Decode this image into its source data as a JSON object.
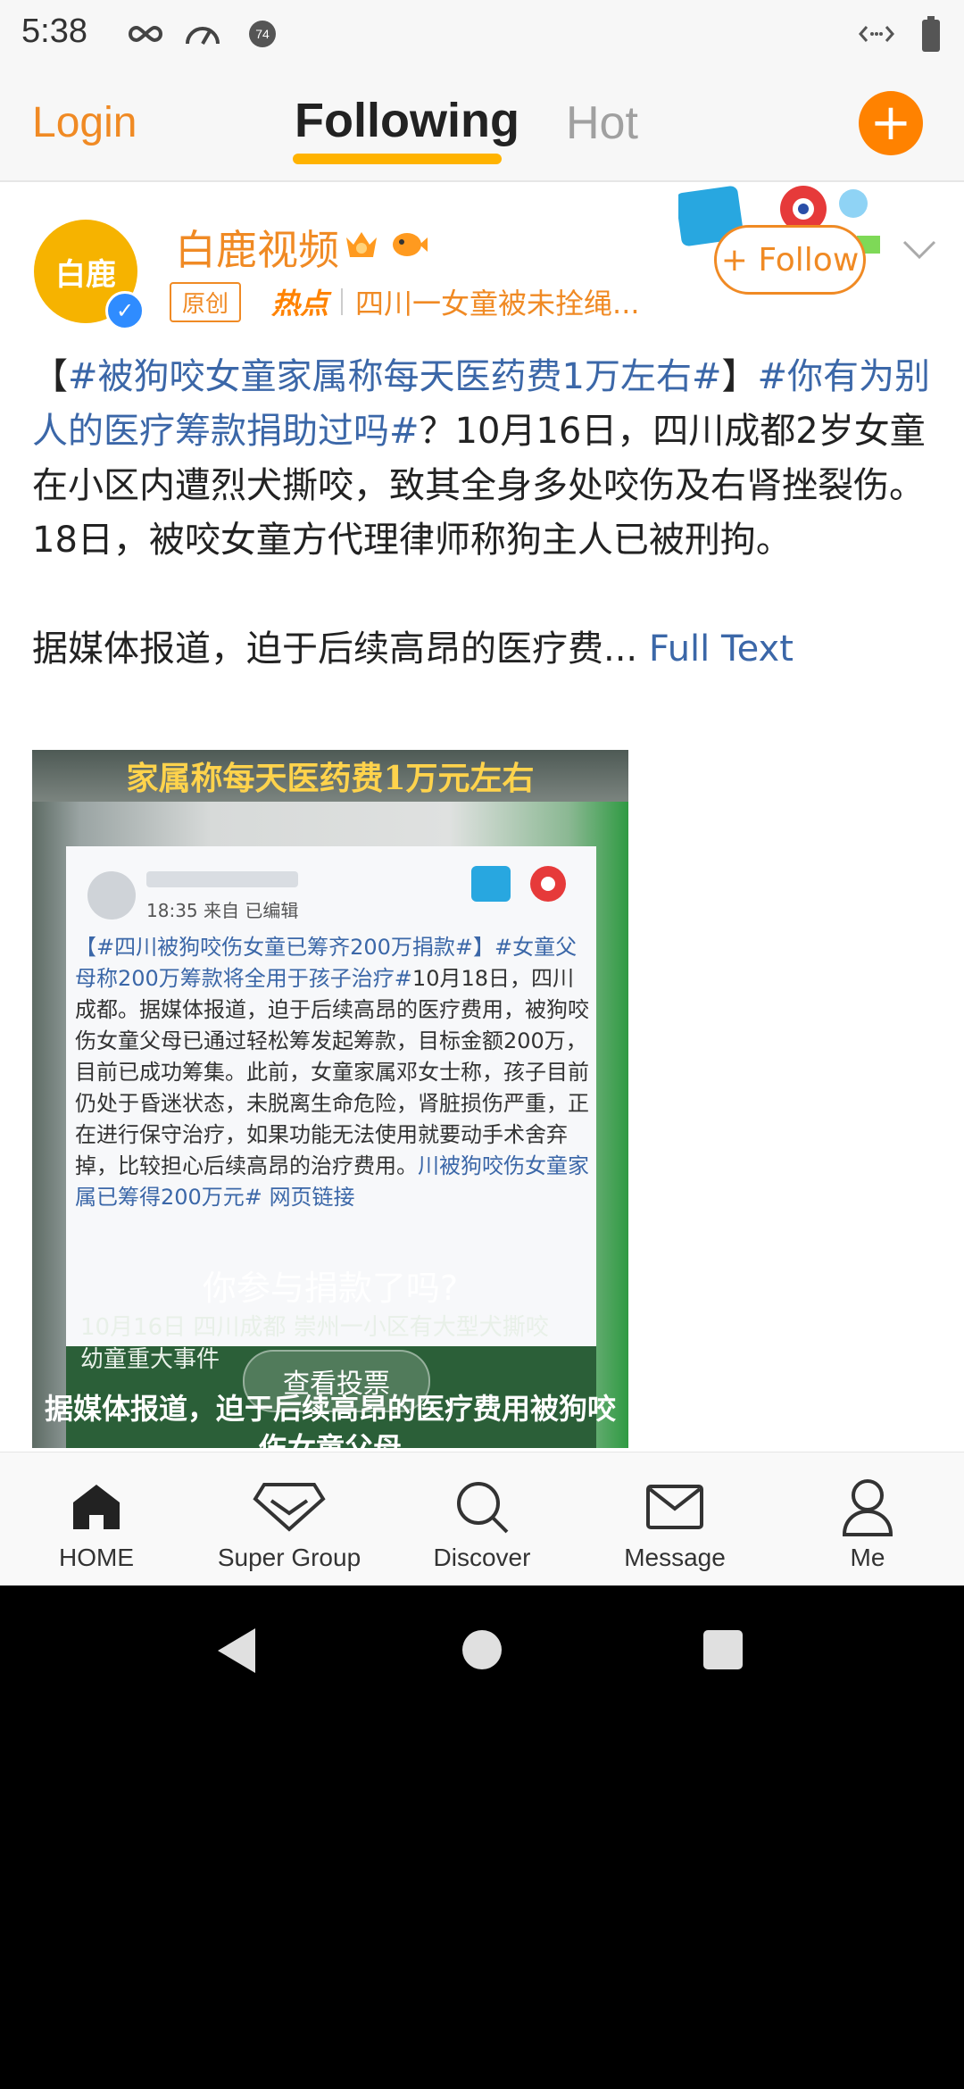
{
  "status_bar": {
    "time": "5:38",
    "badge_number": "74"
  },
  "header": {
    "login_label": "Login",
    "tabs": [
      {
        "label": "Following",
        "active": true
      },
      {
        "label": "Hot",
        "active": false
      }
    ],
    "add_symbol": "+"
  },
  "post": {
    "avatar_text": "白鹿",
    "username": "白鹿视频",
    "original_tag": "原创",
    "hot_label": "热点",
    "hot_topic": "四川一女童被未拴绳...",
    "follow_label": "+ Follow",
    "text": {
      "bracket_open": "【",
      "topic1": "#被狗咬女童家属称每天医药费1万左右#",
      "bracket_close": "】",
      "topic2": "#你有为别人的医疗筹款捐助过吗#",
      "body": "？10月16日，四川成都2岁女童在小区内遭烈犬撕咬，致其全身多处咬伤及右肾挫裂伤。18日，被咬女童方代理律师称狗主人已被刑拘。",
      "para2": "据媒体报道，迫于后续高昂的医疗费...",
      "full_text_label": "Full Text"
    },
    "media": {
      "top_caption": "家属称每天医药费1万元左右",
      "card_meta": "18:35  来自  已编辑",
      "card_topic": "【#四川被狗咬伤女童已筹齐200万捐款#】#女童父母称200万筹款将全用于孩子治疗#",
      "card_body": "10月18日，四川成都。据媒体报道，迫于后续高昂的医疗费用，被狗咬伤女童父母已通过轻松筹发起筹款，目标金额200万，目前已成功筹集。此前，女童家属邓女士称，孩子目前仍处于昏迷状态，未脱离生命危险，肾脏损伤严重，正在进行保守治疗，如果功能无法使用就要动手术舍弃掉，比较担心后续高昂的治疗费用。",
      "card_tail": "川被狗咬伤女童家属已筹得200万元#",
      "card_link": "网页链接",
      "lower_text1": "10月16日 四川成都 崇州一小区有大型犬撕咬",
      "lower_text2": "幼童重大事件",
      "vote_question": "你参与捐款了吗?",
      "vote_button": "查看投票",
      "bottom_caption": "据媒体报道，迫于后续高昂的医疗费用被狗咬伤女童父母"
    }
  },
  "bottom_nav": [
    {
      "label": "HOME",
      "icon": "home-icon"
    },
    {
      "label": "Super Group",
      "icon": "diamond-icon"
    },
    {
      "label": "Discover",
      "icon": "search-icon"
    },
    {
      "label": "Message",
      "icon": "mail-icon"
    },
    {
      "label": "Me",
      "icon": "person-icon"
    }
  ],
  "colors": {
    "accent": "#f08a24",
    "link": "#3b67a8",
    "add_button": "#ff8200",
    "tab_underline": "#ffb300"
  }
}
